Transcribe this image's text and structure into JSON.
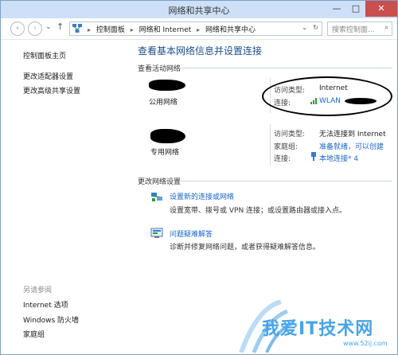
{
  "window": {
    "title": "网络和共享中心",
    "controls": {
      "minimize": "—",
      "maximize": "□",
      "close": "✕"
    }
  },
  "toolbar": {
    "back": "‹",
    "forward": "›",
    "recent": "⌄",
    "up": "↑",
    "breadcrumbs": [
      "控制面板",
      "网络和 Internet",
      "网络和共享中心"
    ],
    "address_dropdown": "⌄",
    "refresh": "↻",
    "search_placeholder": "搜索控制面...",
    "search_icon": "⌕"
  },
  "sidebar": {
    "home_link": "控制面板主页",
    "links": [
      "更改适配器设置",
      "更改高级共享设置"
    ],
    "see_also_label": "另请参阅",
    "see_also": [
      "Internet 选项",
      "Windows 防火墙",
      "家庭组"
    ]
  },
  "main": {
    "heading": "查看基本网络信息并设置连接",
    "active_networks_label": "查看活动网络",
    "networks": [
      {
        "name": "公用网络",
        "access_type_key": "访问类型:",
        "access_type_val": "Internet",
        "connections_key": "连接:",
        "connections_val": "WLAN"
      },
      {
        "name": "专用网络",
        "access_type_key": "访问类型:",
        "access_type_val": "无法连接到 Internet",
        "homegroup_key": "家庭组:",
        "homegroup_val": "准备就绪，可以创建",
        "connections_key": "连接:",
        "connections_val": "本地连接* 4"
      }
    ],
    "change_settings_label": "更改网络设置",
    "tasks": [
      {
        "title": "设置新的连接或网络",
        "desc": "设置宽带、拨号或 VPN 连接；或设置路由器或接入点。",
        "icon": "network-setup-icon"
      },
      {
        "title": "问题疑难解答",
        "desc": "诊断并修复网络问题，或者获得疑难解答信息。",
        "icon": "troubleshoot-icon"
      }
    ]
  },
  "watermark": {
    "text": "我爱IT技术网",
    "url": "www.52ij.com"
  },
  "colors": {
    "heading": "#1e4e8c",
    "link": "#1a66c9",
    "titlebar": "#cde0f7",
    "close": "#c7504f"
  }
}
